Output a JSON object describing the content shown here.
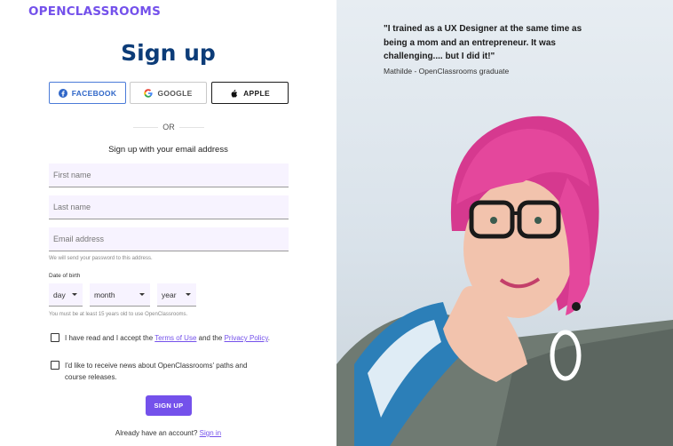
{
  "brand": {
    "logo": "OPENCLASSROOMS",
    "accent": "#7451eb"
  },
  "form": {
    "title": "Sign up",
    "social": {
      "facebook": "FACEBOOK",
      "google": "GOOGLE",
      "apple": "APPLE"
    },
    "or": "OR",
    "subtitle": "Sign up with your email address",
    "fields": {
      "first_name_placeholder": "First name",
      "last_name_placeholder": "Last name",
      "email_placeholder": "Email address"
    },
    "email_hint": "We will send your password to this address.",
    "dob_label": "Date of birth",
    "dob": {
      "day": "day",
      "month": "month",
      "year": "year"
    },
    "age_hint": "You must be at least 15 years old to use OpenClassrooms.",
    "terms": {
      "prefix": "I have read and I accept the",
      "terms_link": "Terms of Use",
      "and": "and the",
      "privacy_link": "Privacy Policy",
      "end": "."
    },
    "newsletter_line1": "I'd like to receive news about OpenClassrooms' paths and",
    "newsletter_line2": "course releases.",
    "submit": "SIGN UP",
    "already": "Already have an account?",
    "signin_link": "Sign in"
  },
  "testimonial": {
    "quote_line1": "\"I trained as a UX Designer at the same time as",
    "quote_line2": "being a mom and an entrepreneur. It was",
    "quote_line3": "challenging.... but I did it!\"",
    "author": "Mathilde - OpenClassrooms graduate"
  }
}
